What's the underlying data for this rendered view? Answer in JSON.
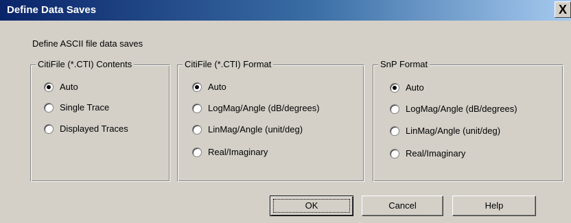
{
  "window": {
    "title": "Define Data Saves",
    "close_label": "X"
  },
  "intro_text": "Define ASCII file data saves",
  "groups": [
    {
      "legend": "CitiFile (*.CTI) Contents",
      "options": [
        "Auto",
        "Single Trace",
        "Displayed Traces"
      ],
      "selected": "Auto"
    },
    {
      "legend": "CitiFile (*.CTI) Format",
      "options": [
        "Auto",
        "LogMag/Angle (dB/degrees)",
        "LinMag/Angle (unit/deg)",
        "Real/Imaginary"
      ],
      "selected": "Auto"
    },
    {
      "legend": "SnP Format",
      "options": [
        "Auto",
        "LogMag/Angle (dB/degrees)",
        "LinMag/Angle (unit/deg)",
        "Real/Imaginary"
      ],
      "selected": "Auto"
    }
  ],
  "buttons": {
    "ok": "OK",
    "cancel": "Cancel",
    "help": "Help"
  }
}
